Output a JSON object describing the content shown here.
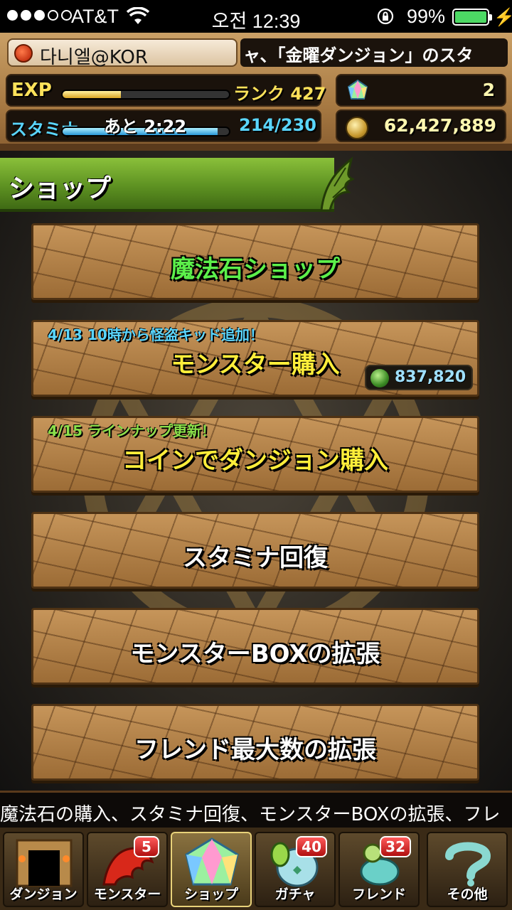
{
  "status_bar": {
    "carrier": "AT&T",
    "time": "오전 12:39",
    "battery_percent": "99%",
    "battery_level": 0.99
  },
  "header": {
    "player_name": "다니엘@KOR",
    "ticker_text": "ャ、「金曜ダンジョン」のスタ",
    "exp_label": "EXP",
    "exp_fill": 0.35,
    "rank_text": "ランク 427",
    "stamina_label": "スタミナ",
    "stamina_remaining": "あと 2:22",
    "stamina_value": "214/230",
    "stamina_fill": 0.93,
    "magic_stone_count": "2",
    "coin_count": "62,427,889"
  },
  "shop": {
    "title": "ショップ",
    "buttons": [
      {
        "label": "魔法石ショップ",
        "label_color": "#5cf04a",
        "note": "",
        "note_color": "",
        "badge": ""
      },
      {
        "label": "モンスター購入",
        "label_color": "#ffee3a",
        "note": "4/13 10時から怪盗キッド追加！",
        "note_color": "#5ad6ff",
        "badge": "837,820"
      },
      {
        "label": "コインでダンジョン購入",
        "label_color": "#ffee3a",
        "note": "4/15 ラインナップ更新！",
        "note_color": "#8ae04a",
        "badge": ""
      },
      {
        "label": "スタミナ回復",
        "label_color": "#ffffff",
        "note": "",
        "note_color": "",
        "badge": ""
      },
      {
        "label": "モンスターBOXの拡張",
        "label_color": "#ffffff",
        "note": "",
        "note_color": "",
        "badge": ""
      },
      {
        "label": "フレンド最大数の拡張",
        "label_color": "#ffffff",
        "note": "",
        "note_color": "",
        "badge": ""
      }
    ]
  },
  "info_ticker": "魔法石の購入、スタミナ回復、モンスターBOXの拡張、フレ",
  "bottom_nav": {
    "items": [
      {
        "label": "ダンジョン",
        "icon": "dungeon-gate-icon",
        "badge": ""
      },
      {
        "label": "モンスター",
        "icon": "red-dragon-icon",
        "badge": "5"
      },
      {
        "label": "ショップ",
        "icon": "magic-stone-icon",
        "badge": ""
      },
      {
        "label": "ガチャ",
        "icon": "egg-icon",
        "badge": "40"
      },
      {
        "label": "フレンド",
        "icon": "friend-monster-icon",
        "badge": "32"
      },
      {
        "label": "その他",
        "icon": "question-mark-icon",
        "badge": ""
      }
    ],
    "active_index": 2
  }
}
